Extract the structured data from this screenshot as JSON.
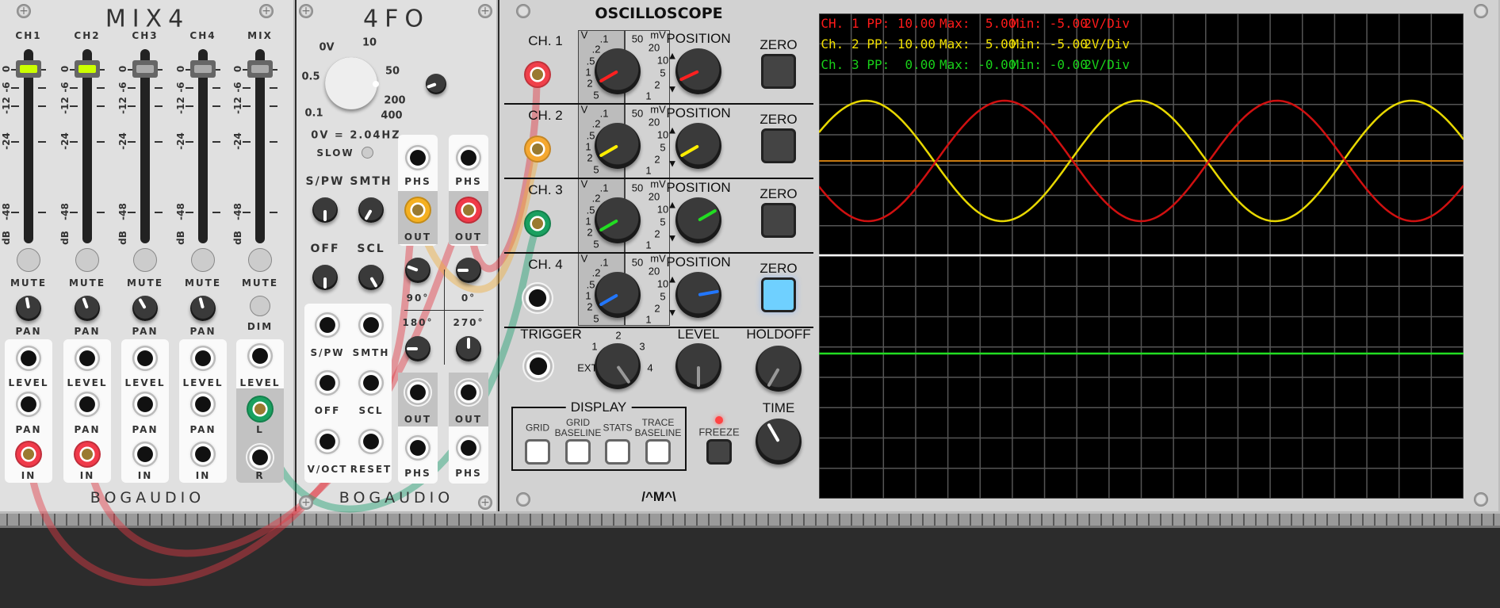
{
  "mix4": {
    "title": "MIX4",
    "brand": "BOGAUDIO",
    "channels": [
      {
        "label": "CH1",
        "mute": "MUTE",
        "pan": "PAN",
        "jacks": [
          "LEVEL",
          "PAN",
          "IN"
        ],
        "fader_color": "#ccff00"
      },
      {
        "label": "CH2",
        "mute": "MUTE",
        "pan": "PAN",
        "jacks": [
          "LEVEL",
          "PAN",
          "IN"
        ],
        "fader_color": "#ccff00"
      },
      {
        "label": "CH3",
        "mute": "MUTE",
        "pan": "PAN",
        "jacks": [
          "LEVEL",
          "PAN",
          "IN"
        ],
        "fader_color": "#aaaaaa"
      },
      {
        "label": "CH4",
        "mute": "MUTE",
        "pan": "PAN",
        "jacks": [
          "LEVEL",
          "PAN",
          "IN"
        ],
        "fader_color": "#aaaaaa"
      },
      {
        "label": "MIX",
        "mute": "MUTE",
        "pan": "DIM",
        "jacks": [
          "LEVEL",
          "L",
          "R"
        ],
        "fader_color": "#aaaaaa"
      }
    ],
    "scale": [
      "0",
      "-6",
      "-12",
      "-24",
      "-48",
      "dB"
    ]
  },
  "lfo": {
    "title": "4FO",
    "brand": "BOGAUDIO",
    "freq_scale": [
      "0V",
      "10",
      "0.5",
      "50",
      "200",
      "0.1",
      "400"
    ],
    "freq_readout": "0V = 2.04HZ",
    "slow": "SLOW",
    "knobs": [
      "S/PW",
      "SMTH",
      "OFF",
      "SCL"
    ],
    "inputs": [
      "S/PW",
      "SMTH",
      "OFF",
      "SCL",
      "V/OCT",
      "RESET"
    ],
    "phs": "PHS",
    "out": "OUT",
    "phases": [
      "90°",
      "0°",
      "180°",
      "270°"
    ]
  },
  "scope": {
    "title": "OSCILLOSCOPE",
    "logo": "/^M^\\",
    "channels": [
      {
        "label": "CH. 1",
        "color": "#ff2020"
      },
      {
        "label": "CH. 2",
        "color": "#ffee00"
      },
      {
        "label": "CH. 3",
        "color": "#22dd22"
      },
      {
        "label": "CH. 4",
        "color": "#2277ff"
      }
    ],
    "volts_scale": [
      "V",
      ".1",
      ".2",
      ".5",
      "1",
      "2",
      "5",
      "50",
      "mV",
      "20",
      "10",
      "5",
      "2",
      "1"
    ],
    "position": "POSITION",
    "zero": "ZERO",
    "trigger": "TRIGGER",
    "ext": "EXT.",
    "trigger_scale": [
      "1",
      "2",
      "3",
      "4"
    ],
    "level": "LEVEL",
    "holdoff": "HOLDOFF",
    "display": "DISPLAY",
    "display_buttons": [
      "GRID",
      "GRID\nBASELINE",
      "STATS",
      "TRACE\nBASELINE"
    ],
    "freeze": "FREEZE",
    "time": "TIME",
    "stats": [
      {
        "ch": "CH. 1",
        "pp": "PP: 10.00",
        "max": "Max:  5.00",
        "min": "Min: -5.00",
        "div": "2V/Div",
        "color": "#ff1a1a"
      },
      {
        "ch": "Ch. 2",
        "pp": "PP: 10.00",
        "max": "Max:  5.00",
        "min": "Min: -5.00",
        "div": "2V/Div",
        "color": "#f0e000"
      },
      {
        "ch": "Ch. 3",
        "pp": "PP:  0.00",
        "max": "Max: -0.00",
        "min": "Min: -0.00",
        "div": "2V/Div",
        "color": "#19d019"
      }
    ]
  }
}
